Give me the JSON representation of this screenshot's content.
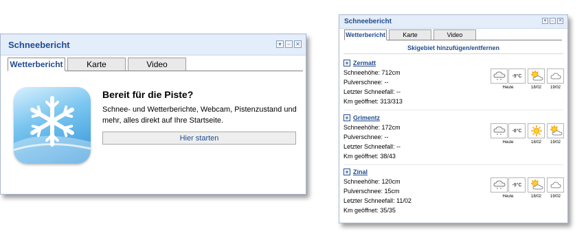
{
  "large_widget": {
    "title": "Schneebericht",
    "tabs": [
      "Wetterbericht",
      "Karte",
      "Video"
    ],
    "heading": "Bereit für die Piste?",
    "description": "Schnee- und Wetterberichte, Webcam, Pistenzustand und mehr, alles direkt auf Ihre Startseite.",
    "start_button": "Hier starten",
    "icon": "snowflake-icon"
  },
  "small_widget": {
    "title": "Schneebericht",
    "tabs": [
      "Wetterbericht",
      "Karte",
      "Video"
    ],
    "add_link": "Skigebiet hinzufügen/entfernen",
    "resorts": [
      {
        "name": "Zermatt",
        "lines": [
          "Schneehöhe: 712cm",
          "Pulverschnee: --",
          "Letzter Schneefall: --",
          "Km geöffnet: 313/313"
        ],
        "forecast": [
          {
            "icon": "cloud-snow-icon",
            "label": "Heute"
          },
          {
            "temp": "-9°C"
          },
          {
            "icon": "sun-cloud-icon",
            "label": "18/02"
          },
          {
            "icon": "cloud-icon",
            "label": "19/02"
          }
        ]
      },
      {
        "name": "Grimentz",
        "lines": [
          "Schneehöhe: 172cm",
          "Pulverschnee: --",
          "Letzter Schneefall: --",
          "Km geöffnet: 38/43"
        ],
        "forecast": [
          {
            "icon": "cloud-snow-icon",
            "label": "Heute"
          },
          {
            "temp": "-8°C"
          },
          {
            "icon": "sun-icon",
            "label": "18/02"
          },
          {
            "icon": "sun-cloud-icon",
            "label": "19/02"
          }
        ]
      },
      {
        "name": "Zinal",
        "lines": [
          "Schneehöhe: 120cm",
          "Pulverschnee: 15cm",
          "Letzter Schneefall: 11/02",
          "Km geöffnet: 35/35"
        ],
        "forecast": [
          {
            "icon": "cloud-snow-icon",
            "label": "Heute"
          },
          {
            "temp": "-9°C"
          },
          {
            "icon": "sun-cloud-icon",
            "label": "18/02"
          },
          {
            "icon": "cloud-icon",
            "label": "19/02"
          }
        ]
      }
    ]
  },
  "colors": {
    "accent": "#1f4c8f",
    "titlebar": "#e4edfa",
    "border": "#a9b8cf"
  }
}
